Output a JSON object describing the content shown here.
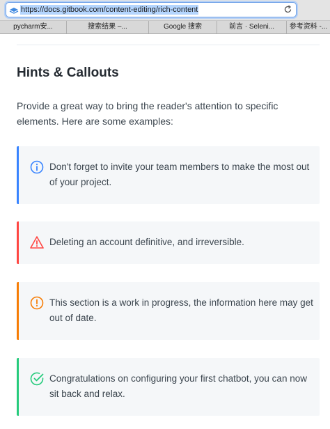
{
  "browser": {
    "url": "https://docs.gitbook.com/content-editing/rich-content",
    "bookmarks": [
      "pycharm安...",
      "搜索结果 –...",
      "Google 搜索",
      "前言 · Seleni...",
      "参考资料 -..."
    ]
  },
  "page": {
    "heading": "Hints & Callouts",
    "intro": "Provide a great way to bring the reader's attention to specific elements. Here are some examples:"
  },
  "hints": [
    {
      "type": "info",
      "icon": "info-circle-icon",
      "color": "#3884ff",
      "text": "Don't forget to invite your team members to make the most out of your project."
    },
    {
      "type": "danger",
      "icon": "warning-triangle-icon",
      "color": "#ff4642",
      "text": "Deleting an account definitive, and irreversible."
    },
    {
      "type": "warning",
      "icon": "exclamation-circle-icon",
      "color": "#f77d05",
      "text": "This section is a work in progress, the information here may get out of date."
    },
    {
      "type": "success",
      "icon": "check-circle-icon",
      "color": "#26cb7c",
      "text": "Congratulations on configuring your first chatbot, you can now sit back and relax."
    }
  ]
}
